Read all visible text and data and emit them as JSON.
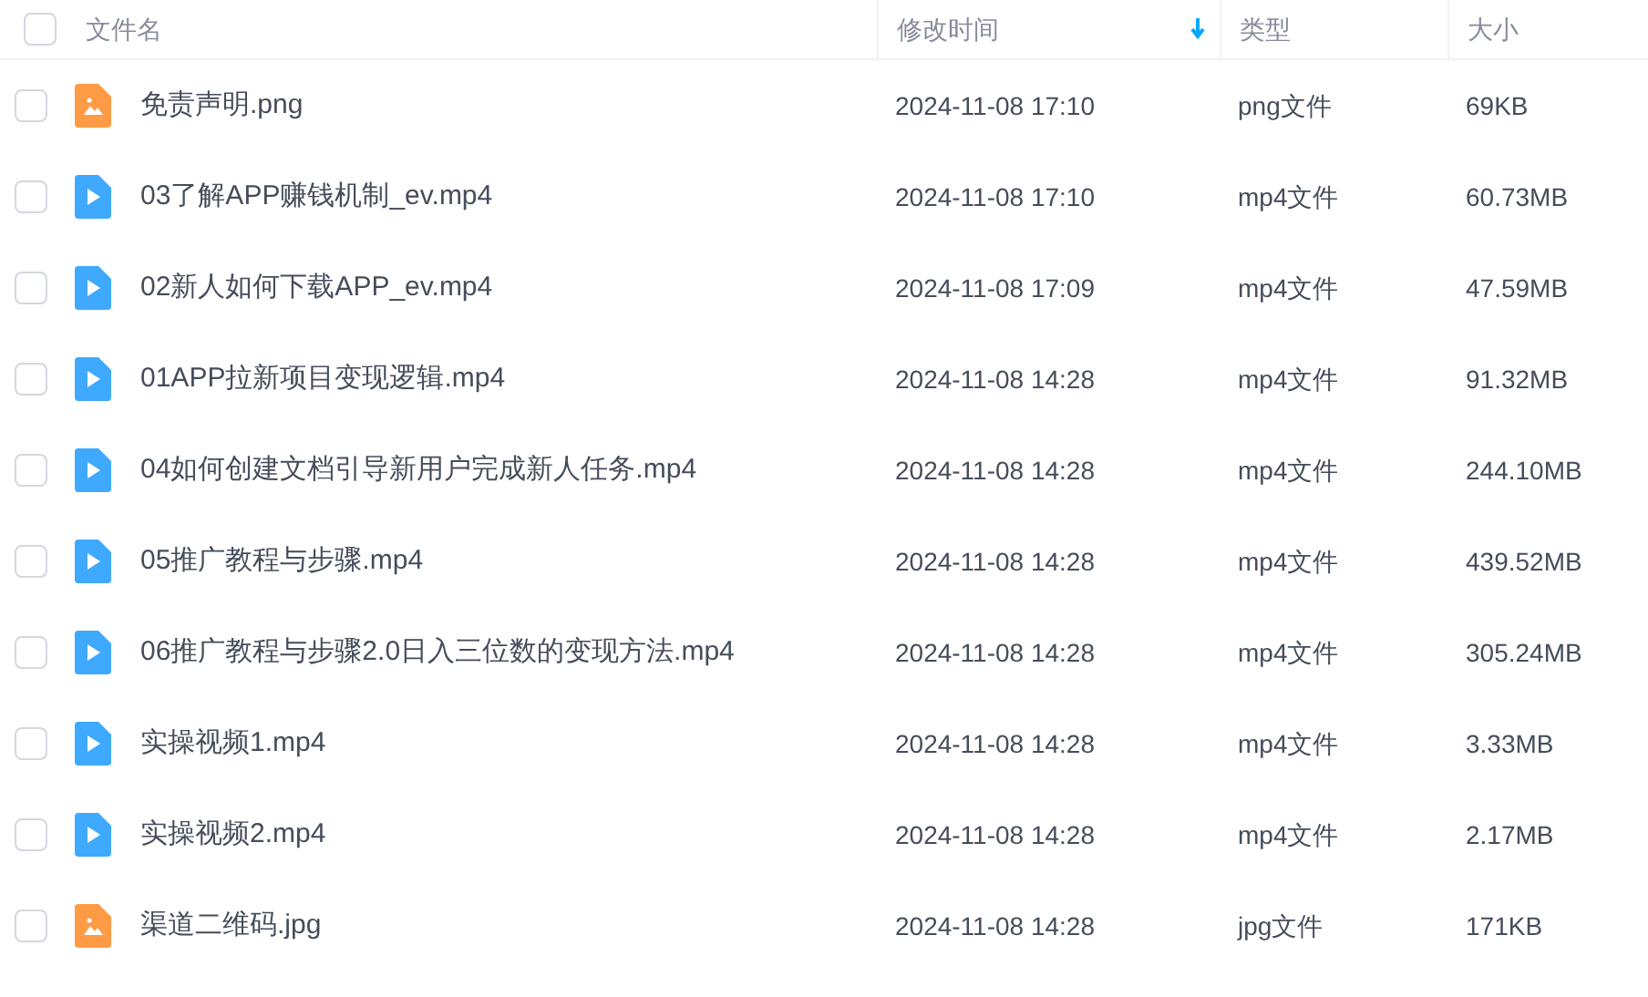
{
  "header": {
    "checked": false,
    "columns": [
      {
        "label": "文件名",
        "sorted": false
      },
      {
        "label": "修改时间",
        "sorted": true
      },
      {
        "label": "类型",
        "sorted": false
      },
      {
        "label": "大小",
        "sorted": false
      }
    ]
  },
  "rows": [
    {
      "kind": "image",
      "name": "免责声明.png",
      "modified": "2024-11-08 17:10",
      "type": "png文件",
      "size": "69KB",
      "checked": false
    },
    {
      "kind": "video",
      "name": "03了解APP赚钱机制_ev.mp4",
      "modified": "2024-11-08 17:10",
      "type": "mp4文件",
      "size": "60.73MB",
      "checked": false
    },
    {
      "kind": "video",
      "name": "02新人如何下载APP_ev.mp4",
      "modified": "2024-11-08 17:09",
      "type": "mp4文件",
      "size": "47.59MB",
      "checked": false
    },
    {
      "kind": "video",
      "name": "01APP拉新项目变现逻辑.mp4",
      "modified": "2024-11-08 14:28",
      "type": "mp4文件",
      "size": "91.32MB",
      "checked": false
    },
    {
      "kind": "video",
      "name": "04如何创建文档引导新用户完成新人任务.mp4",
      "modified": "2024-11-08 14:28",
      "type": "mp4文件",
      "size": "244.10MB",
      "checked": false
    },
    {
      "kind": "video",
      "name": "05推广教程与步骤.mp4",
      "modified": "2024-11-08 14:28",
      "type": "mp4文件",
      "size": "439.52MB",
      "checked": false
    },
    {
      "kind": "video",
      "name": "06推广教程与步骤2.0日入三位数的变现方法.mp4",
      "modified": "2024-11-08 14:28",
      "type": "mp4文件",
      "size": "305.24MB",
      "checked": false
    },
    {
      "kind": "video",
      "name": "实操视频1.mp4",
      "modified": "2024-11-08 14:28",
      "type": "mp4文件",
      "size": "3.33MB",
      "checked": false
    },
    {
      "kind": "video",
      "name": "实操视频2.mp4",
      "modified": "2024-11-08 14:28",
      "type": "mp4文件",
      "size": "2.17MB",
      "checked": false
    },
    {
      "kind": "image",
      "name": "渠道二维码.jpg",
      "modified": "2024-11-08 14:28",
      "type": "jpg文件",
      "size": "171KB",
      "checked": false
    }
  ]
}
